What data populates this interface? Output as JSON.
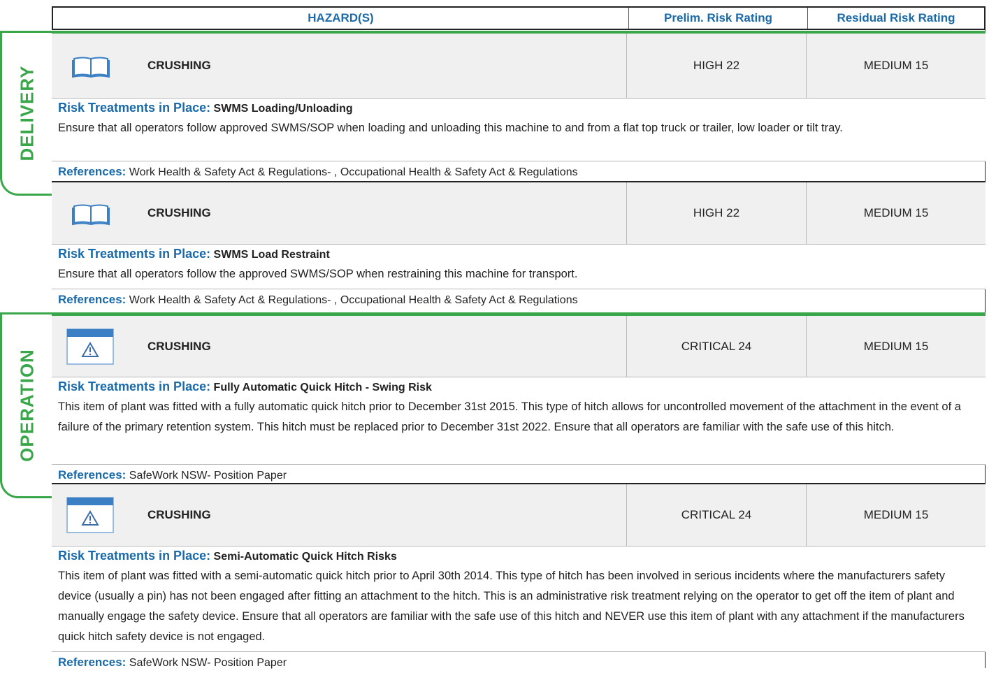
{
  "header": {
    "hazards": "HAZARD(S)",
    "prelim": "Prelim. Risk Rating",
    "residual": "Residual Risk Rating"
  },
  "sections": [
    {
      "label": "DELIVERY"
    },
    {
      "label": "OPERATION"
    }
  ],
  "hazards": [
    {
      "icon": "book-icon",
      "name": "CRUSHING",
      "prelim": "HIGH 22",
      "residual": "MEDIUM 15",
      "treatment_label": "Risk Treatments in Place:",
      "treatment_title": "SWMS Loading/Unloading",
      "treatment_body": "Ensure that all operators follow approved SWMS/SOP when loading and unloading this machine to and from a flat top truck or trailer, low loader or tilt tray.",
      "references_label": "References:",
      "references": "Work Health & Safety Act & Regulations- , Occupational Health & Safety Act & Regulations"
    },
    {
      "icon": "book-icon",
      "name": "CRUSHING",
      "prelim": "HIGH 22",
      "residual": "MEDIUM 15",
      "treatment_label": "Risk Treatments in Place:",
      "treatment_title": "SWMS Load Restraint",
      "treatment_body": "Ensure that all operators follow the approved SWMS/SOP when restraining this machine for transport.",
      "references_label": "References:",
      "references": "Work Health & Safety Act & Regulations- , Occupational Health & Safety Act & Regulations"
    },
    {
      "icon": "warning-window-icon",
      "name": "CRUSHING",
      "prelim": "CRITICAL 24",
      "residual": "MEDIUM 15",
      "treatment_label": "Risk Treatments in Place:",
      "treatment_title": "Fully Automatic Quick Hitch - Swing Risk",
      "treatment_body": "This item of plant was fitted with a fully automatic quick hitch prior to December 31st 2015. This type of hitch allows for uncontrolled movement of the attachment in the event of a failure of the primary retention system. This hitch must be replaced prior to December 31st 2022. Ensure that all operators are familiar with the safe use of this hitch.",
      "references_label": "References:",
      "references": "SafeWork NSW- Position Paper"
    },
    {
      "icon": "warning-window-icon",
      "name": "CRUSHING",
      "prelim": "CRITICAL 24",
      "residual": "MEDIUM 15",
      "treatment_label": "Risk Treatments in Place:",
      "treatment_title": "Semi-Automatic Quick Hitch Risks",
      "treatment_body": "This item of plant was fitted with a semi-automatic quick hitch prior to April 30th 2014. This type of hitch has been involved in serious incidents where the manufacturers safety device (usually a pin) has not been engaged after fitting an attachment to the hitch. This is an administrative risk treatment relying on the operator to get off the item of plant and manually engage the safety device.  Ensure that all operators are familiar with the safe use of this hitch and NEVER use this item of plant with any attachment if the manufacturers quick hitch safety device is not engaged.",
      "references_label": "References:",
      "references": "SafeWork NSW- Position Paper"
    }
  ],
  "colors": {
    "accent_blue": "#1a6aa9",
    "section_green": "#3aa64a",
    "row_grey": "#f0f0f0"
  }
}
